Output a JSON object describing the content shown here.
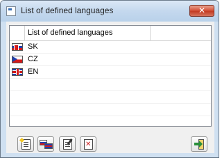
{
  "window": {
    "title": "List of defined languages",
    "close_glyph": "✕"
  },
  "list": {
    "column_header": "List of defined languages",
    "rows": [
      {
        "code": "SK",
        "flag_icon": "slovakia-flag-icon"
      },
      {
        "code": "CZ",
        "flag_icon": "czech-flag-icon"
      },
      {
        "code": "EN",
        "flag_icon": "uk-flag-icon"
      }
    ]
  },
  "toolbar": {
    "buttons": [
      {
        "icon": "new-document-icon"
      },
      {
        "icon": "language-flags-icon"
      },
      {
        "icon": "edit-document-icon"
      },
      {
        "icon": "delete-document-icon"
      },
      {
        "icon": "exit-door-icon"
      }
    ]
  },
  "colors": {
    "title_bar": "#c4d8ee",
    "close_button": "#c43b24",
    "client_bg": "#f0f0f0"
  }
}
